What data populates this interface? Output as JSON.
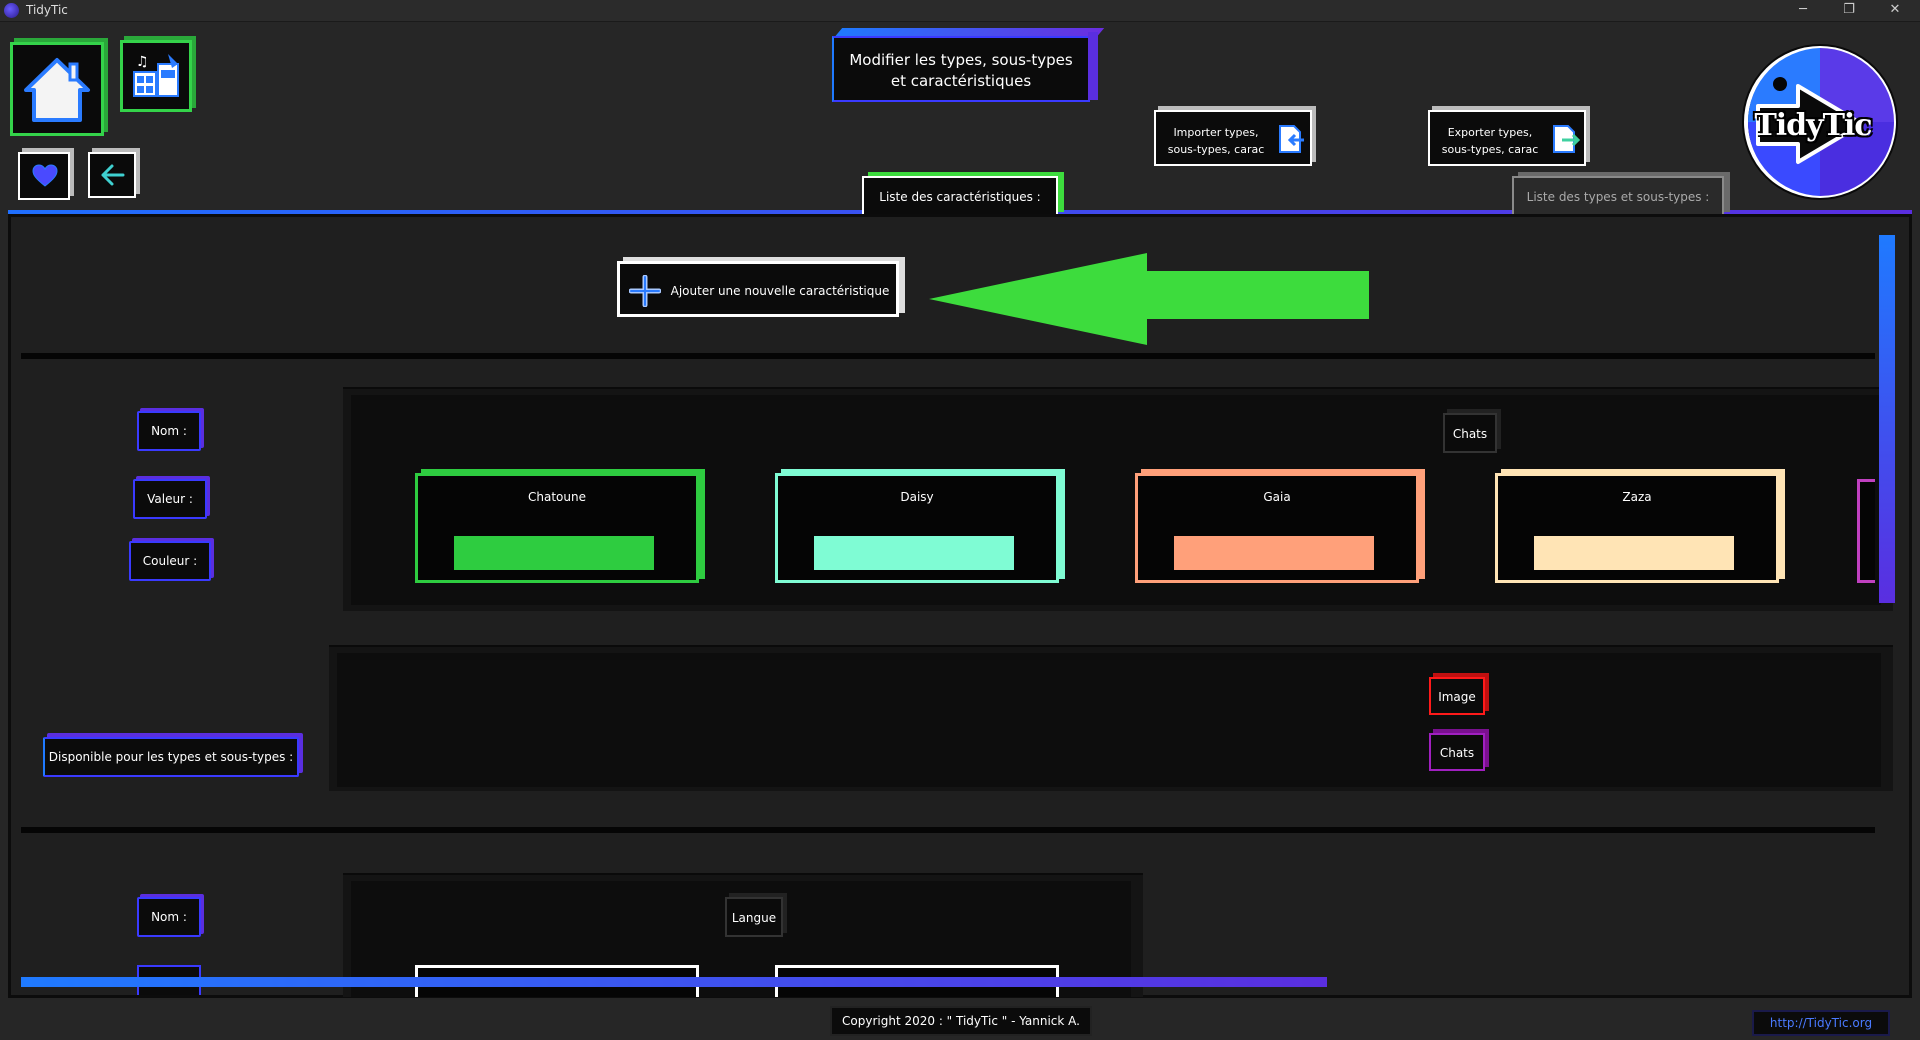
{
  "window": {
    "title": "TidyTic",
    "minimize": "─",
    "restore": "❐",
    "close": "✕"
  },
  "header": {
    "page_title_line1": "Modifier les types, sous-types",
    "page_title_line2": "et caractéristiques",
    "import_line1": "Importer types,",
    "import_line2": "sous-types, carac",
    "export_line1": "Exporter types,",
    "export_line2": "sous-types, carac",
    "tab_characteristics": "Liste des caractéristiques :",
    "tab_types": "Liste des types et sous-types :",
    "logo_text": "TidyTic"
  },
  "main": {
    "add_button_label": "Ajouter une nouvelle caractéristique",
    "characteristic1": {
      "name_label": "Nom :",
      "value_label": "Valeur :",
      "color_label": "Couleur :",
      "name_value": "Chats",
      "values": [
        {
          "name": "Chatoune",
          "color": "#2ecc40"
        },
        {
          "name": "Daisy",
          "color": "#7ffcd4"
        },
        {
          "name": "Gaia",
          "color": "#ffa07a"
        },
        {
          "name": "Zaza",
          "color": "#ffe4b5"
        }
      ],
      "available_label": "Disponible pour les types et sous-types :",
      "available_types": [
        {
          "label": "Image",
          "color": "#ff1a1a"
        },
        {
          "label": "Chats",
          "color": "#a020c0"
        }
      ]
    },
    "characteristic2": {
      "name_label": "Nom :",
      "name_value": "Langue"
    }
  },
  "footer": {
    "copyright": "Copyright 2020 : \" TidyTic \" - Yannick A.",
    "website": "http://TidyTic.org"
  },
  "colors": {
    "accent_blue": "#1f6fff",
    "accent_purple": "#5a2ee0",
    "accent_green": "#3ddc3d"
  }
}
